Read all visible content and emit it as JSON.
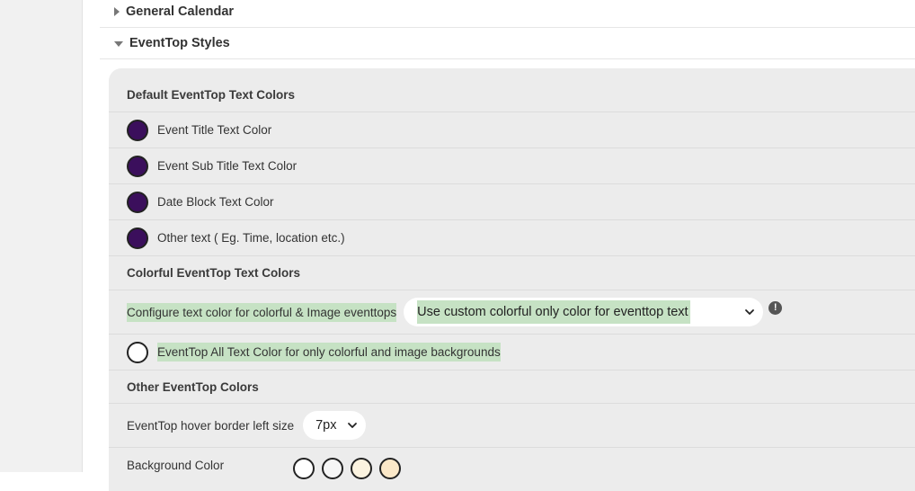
{
  "sections": {
    "general_calendar": "General Calendar",
    "eventtop_styles": "EventTop Styles"
  },
  "default_colors": {
    "heading": "Default EventTop Text Colors",
    "items": [
      {
        "label": "Event Title Text Color",
        "color": "#3b0f5c"
      },
      {
        "label": "Event Sub Title Text Color",
        "color": "#3b0f5c"
      },
      {
        "label": "Date Block Text Color",
        "color": "#3b0f5c"
      },
      {
        "label": "Other text ( Eg. Time, location etc.)",
        "color": "#3b0f5c"
      }
    ]
  },
  "colorful": {
    "heading": "Colorful EventTop Text Colors",
    "configure_label": "Configure text color for colorful & Image eventtops",
    "select_value": "Use custom colorful only color for eventtop text",
    "info_icon": "!",
    "all_text_color_label": "EventTop All Text Color for only colorful and image backgrounds",
    "all_text_color": "#ffffff"
  },
  "other": {
    "heading": "Other EventTop Colors",
    "hover_border_label": "EventTop hover border left size",
    "hover_border_value": "7px",
    "background_label": "Background Color",
    "background_swatches": [
      "#ffffff",
      "#f6f6f6",
      "#fbf3e0",
      "#fbe8c8"
    ]
  },
  "highlight_color": "#c6e2c4"
}
